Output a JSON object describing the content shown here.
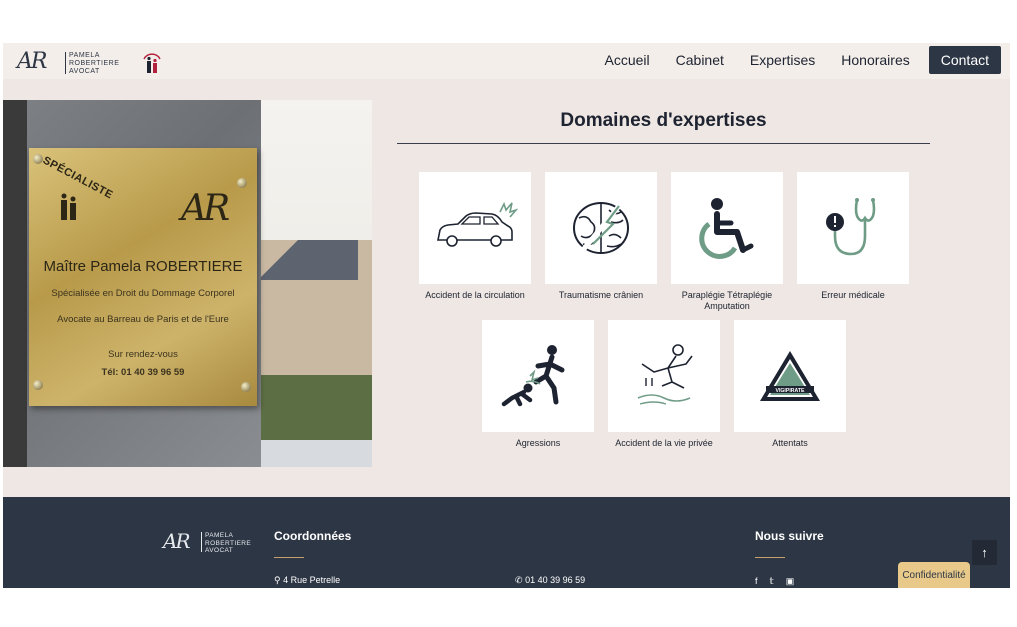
{
  "brand": {
    "monogram": "AR",
    "name_lines": [
      "PAMELA",
      "ROBERTIERE",
      "AVOCAT"
    ],
    "badge_label": "SPÉCIALISTE"
  },
  "nav": {
    "items": [
      "Accueil",
      "Cabinet",
      "Expertises",
      "Honoraires"
    ],
    "contact_label": "Contact"
  },
  "plaque": {
    "specialiste": "SPÉCIALISTE",
    "monogram": "AR",
    "name": "Maître Pamela ROBERTIERE",
    "line2": "Spécialisée en Droit du Dommage Corporel",
    "line3": "Avocate au Barreau de Paris et de l'Eure",
    "line4": "Sur rendez-vous",
    "tel": "Tél: 01 40 39 96 59"
  },
  "main": {
    "title": "Domaines d'expertises",
    "cards": [
      {
        "label": "Accident de la circulation",
        "icon": "car-crash-icon"
      },
      {
        "label": "Traumatisme crânien",
        "icon": "brain-icon"
      },
      {
        "label": "Paraplégie Tétraplégie Amputation",
        "icon": "wheelchair-icon"
      },
      {
        "label": "Erreur médicale",
        "icon": "stethoscope-icon"
      },
      {
        "label": "Agressions",
        "icon": "assault-icon"
      },
      {
        "label": "Accident de la vie privée",
        "icon": "fall-icon"
      },
      {
        "label": "Attentats",
        "icon": "vigipirate-icon"
      }
    ],
    "vigipirate_text": "VIGIPIRATE"
  },
  "footer": {
    "monogram": "AR",
    "name_lines": [
      "PAMELA",
      "ROBERTIERE",
      "AVOCAT"
    ],
    "coord_heading": "Coordonnées",
    "address": "4 Rue Petrelle",
    "phone": "01 40 39 96 59",
    "follow_heading": "Nous suivre",
    "social": [
      "facebook-icon",
      "twitter-icon",
      "linkedin-icon"
    ]
  },
  "widgets": {
    "back_to_top": "↑",
    "confidentiality": "Confidentialité"
  },
  "colors": {
    "navy": "#2d3644",
    "page_bg": "#efe7e3",
    "accent_green": "#6f9c86",
    "gold": "#c8a06a"
  }
}
